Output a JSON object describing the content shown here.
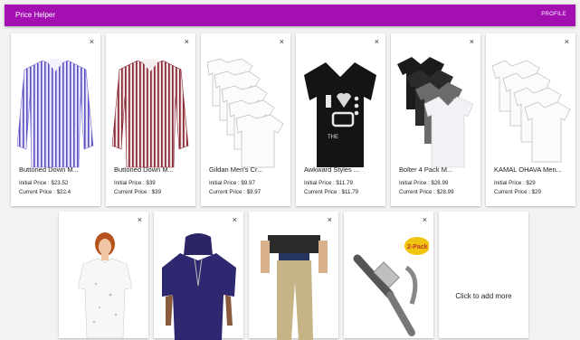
{
  "app": {
    "title": "Price Helper",
    "profile_label": "PROFILE"
  },
  "close_glyph": "×",
  "products_row1": [
    {
      "name": "Buttoned Down M...",
      "initial": "Initial Price : $23.52",
      "current": "Current Price : $22.4",
      "icon": "purple-striped-shirt"
    },
    {
      "name": "Buttoned Down M...",
      "initial": "Initial Price : $39",
      "current": "Current Price : $39",
      "icon": "red-striped-shirt"
    },
    {
      "name": "Gildan Men's Cr...",
      "initial": "Initial Price : $9.97",
      "current": "Current Price : $9.97",
      "icon": "white-tshirt-pack"
    },
    {
      "name": "Awkward Styles ...",
      "initial": "Initial Price : $11.79",
      "current": "Current Price : $11.79",
      "icon": "black-80s-tshirt"
    },
    {
      "name": "Bolter 4 Pack M...",
      "initial": "Initial Price : $28.99",
      "current": "Current Price : $28.99",
      "icon": "vneck-tshirt-pack"
    },
    {
      "name": "KAMAL OHAVA Men...",
      "initial": "Initial Price : $29",
      "current": "Current Price : $29",
      "icon": "white-tshirt-pack"
    }
  ],
  "products_row2": [
    {
      "icon": "distressed-white-top"
    },
    {
      "icon": "purple-hooded-shirt"
    },
    {
      "icon": "khaki-pants"
    },
    {
      "icon": "usb-c-cable",
      "badge": "2-Pack"
    }
  ],
  "add_card": {
    "label": "Click to add more"
  }
}
